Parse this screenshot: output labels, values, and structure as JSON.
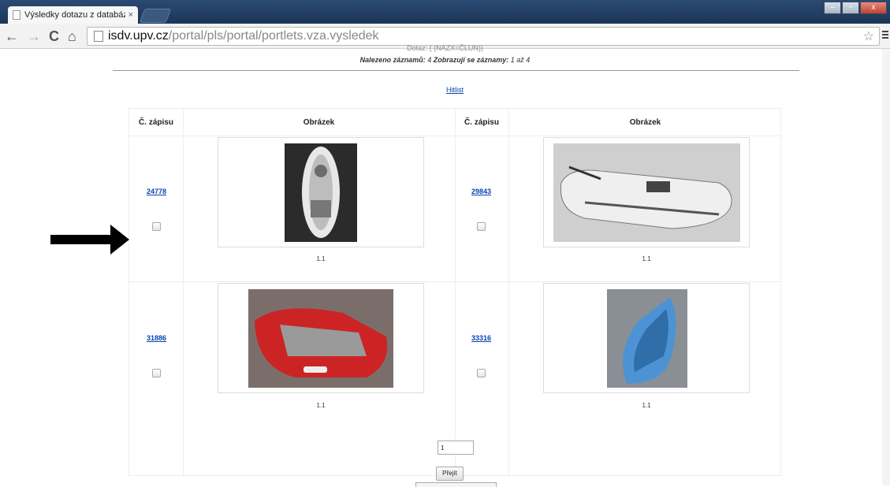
{
  "browser": {
    "tab_title": "Výsledky dotazu z databáz",
    "tab_close": "×",
    "url_host": "isdv.upv.cz",
    "url_path": "/portal/pls/portal/portlets.vza.vysledek",
    "back_icon": "←",
    "forward_icon": "→",
    "reload_icon": "C",
    "home_icon": "⌂",
    "star_icon": "☆",
    "minimize": "–",
    "maximize": "▫",
    "close": "x"
  },
  "query": {
    "line1": "Dotaz: ( (NAZX=ČLUN))",
    "line2_prefix": "Nalezeno záznamů:",
    "line2_count": "4",
    "line2_mid": "Zobrazují se záznamy:",
    "line2_range": "1 až 4"
  },
  "hitlist_link": "Hitlist",
  "table": {
    "headers": [
      "Č. zápisu",
      "Obrázek",
      "Č. zápisu",
      "Obrázek"
    ],
    "rows": [
      [
        {
          "number": "24778",
          "caption": "1.1"
        },
        {
          "number": "29843",
          "caption": "1.1"
        }
      ],
      [
        {
          "number": "31886",
          "caption": "1.1"
        },
        {
          "number": "33316",
          "caption": "1.1"
        }
      ]
    ]
  },
  "pager": {
    "page_value": "1",
    "go_label": "Přejít"
  },
  "colors": {
    "link": "#0645ad",
    "arrow": "#000000"
  }
}
